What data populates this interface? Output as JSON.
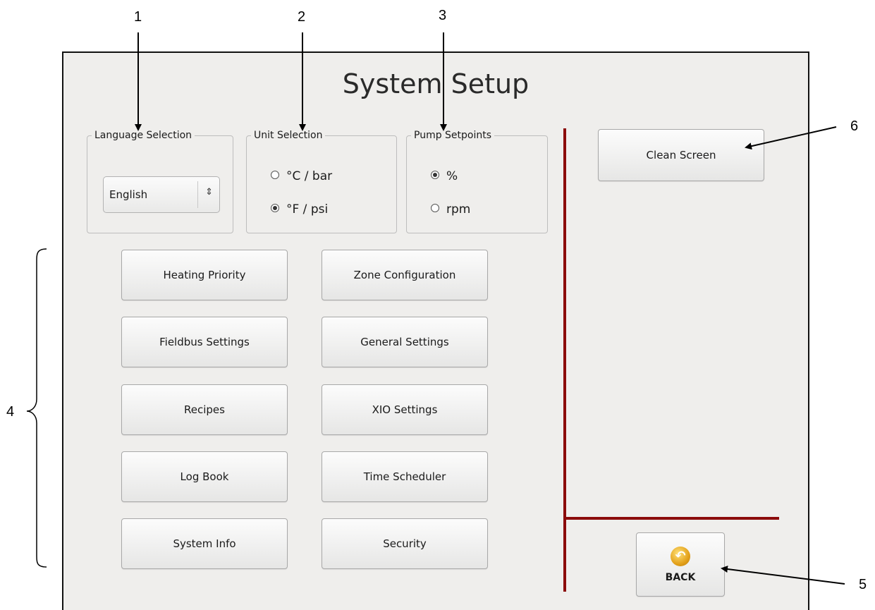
{
  "callouts": {
    "c1": "1",
    "c2": "2",
    "c3": "3",
    "c4": "4",
    "c5": "5",
    "c6": "6"
  },
  "screen": {
    "title": "System Setup"
  },
  "language": {
    "legend": "Language Selection",
    "selected": "English"
  },
  "units": {
    "legend": "Unit Selection",
    "options": [
      {
        "label": "°C / bar",
        "checked": false
      },
      {
        "label": "°F / psi",
        "checked": true
      }
    ]
  },
  "pump": {
    "legend": "Pump Setpoints",
    "options": [
      {
        "label": "%",
        "checked": true
      },
      {
        "label": "rpm",
        "checked": false
      }
    ]
  },
  "menu": {
    "buttons": [
      "Heating Priority",
      "Zone Configuration",
      "Fieldbus Settings",
      "General Settings",
      "Recipes",
      "XIO Settings",
      "Log Book",
      "Time Scheduler",
      "System Info",
      "Security"
    ]
  },
  "right_panel": {
    "clean_screen": "Clean Screen",
    "back": "BACK",
    "back_icon": "back-arrow-icon"
  },
  "colors": {
    "divider": "#8b0b0b",
    "panel": "#efeeec"
  }
}
